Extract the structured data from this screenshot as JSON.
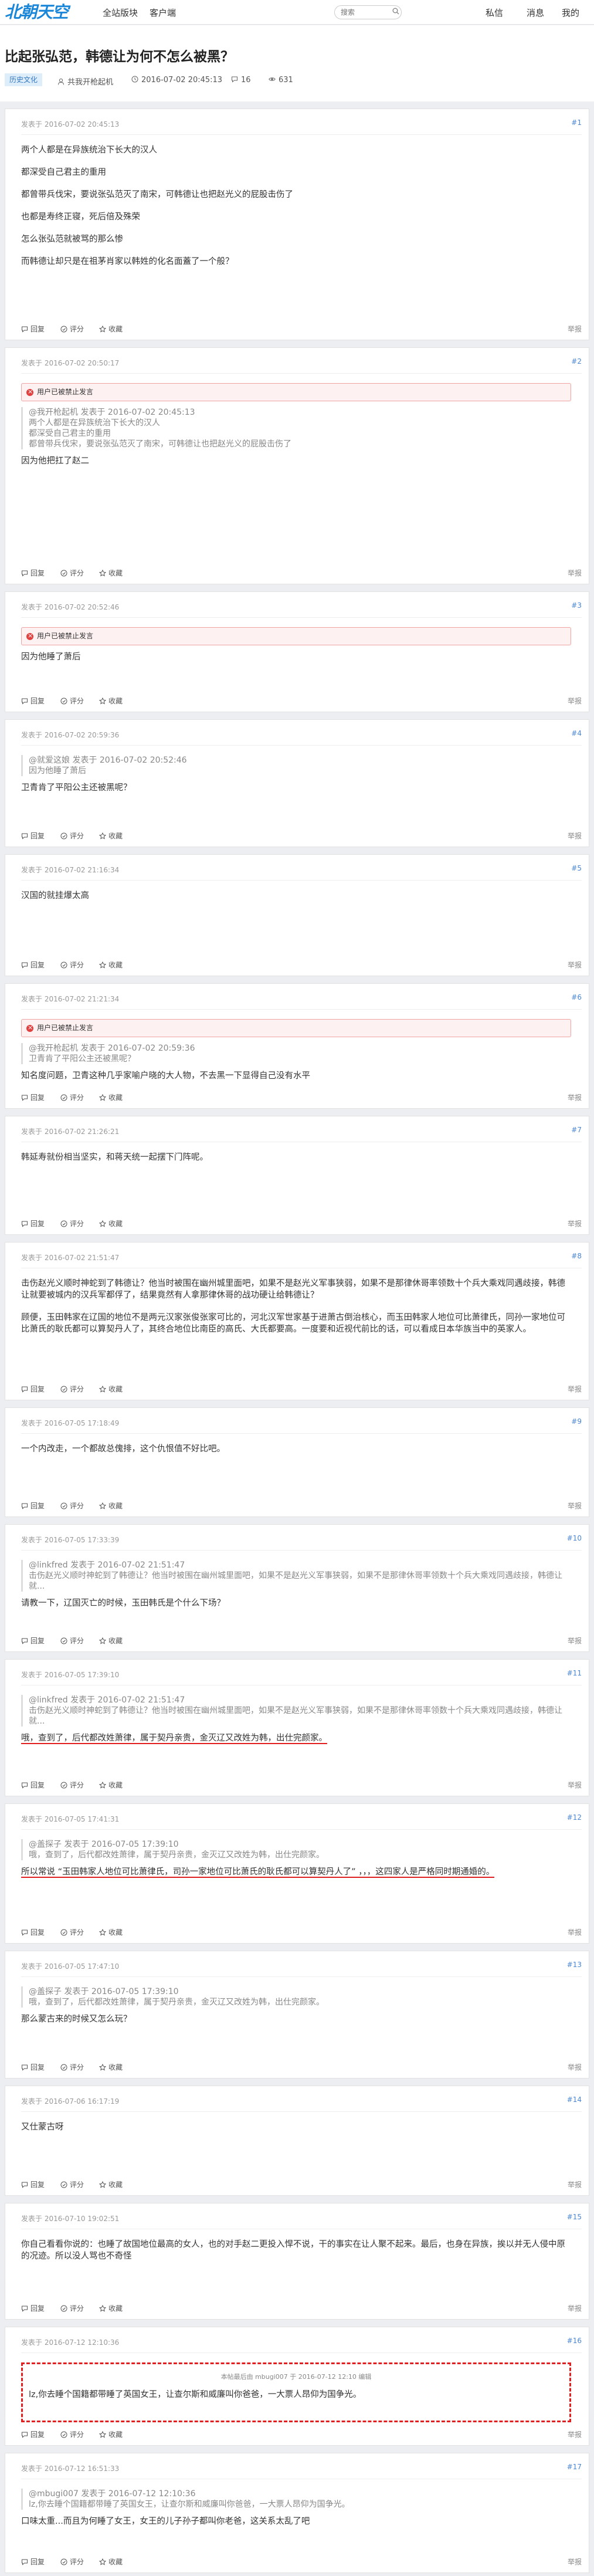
{
  "site": {
    "logo": "北朝天空",
    "nav": [
      "全站版块",
      "客户端"
    ],
    "search_placeholder": "搜索",
    "right_nav": [
      "私信",
      "消息",
      "我的"
    ]
  },
  "thread": {
    "title": "比起张弘范，韩德让为何不怎么被黑？",
    "tag": "历史文化",
    "author": "共我开枪起机",
    "date": "2016-07-02 20:45:13",
    "comments": "16",
    "views": "631"
  },
  "labels": {
    "reply": "回复",
    "rate": "评分",
    "fav": "收藏",
    "report": "举报",
    "deleted": "用户已被禁止发言"
  },
  "posts": [
    {
      "head": "发表于 2016-07-02 20:45:13",
      "floor": "#1",
      "lines": [
        "两个人都是在异族统治下长大的汉人",
        "都深受自己君主的重用",
        "都曾带兵伐宋，要说张弘范灭了南宋，可韩德让也把赵光义的屁股击伤了",
        "也都是寿终正寝，死后倍及殊荣",
        "怎么张弘范就被骂的那么惨",
        "而韩德让却只是在祖茅肖家以韩姓的化名面蓋了一个般？"
      ]
    },
    {
      "head": "发表于 2016-07-02 20:50:17",
      "floor": "#2",
      "quote": [
        "@我开枪起机 发表于 2016-07-02 20:45:13",
        "两个人都是在异族统治下长大的汉人",
        "都深受自己君主的重用",
        "都曾带兵伐宋，要说张弘范灭了南宋，可韩德让也把赵光义的屁股击伤了"
      ],
      "lines": [
        "因为他把扛了赵二"
      ]
    },
    {
      "head": "发表于 2016-07-02 20:52:46",
      "floor": "#3",
      "lines": [
        "因为他睡了萧后"
      ]
    },
    {
      "head": "发表于 2016-07-02 20:59:36",
      "floor": "#4",
      "quote": [
        "@就爱这娘 发表于 2016-07-02 20:52:46",
        "因为他睡了萧后"
      ],
      "lines": [
        "卫青肯了平阳公主还被黑呢？"
      ]
    },
    {
      "head": "发表于 2016-07-02 21:16:34",
      "floor": "#5",
      "lines": [
        "汉国的就挂爆太高"
      ]
    },
    {
      "head": "发表于 2016-07-02 21:21:34",
      "floor": "#6",
      "quote": [
        "@我开枪起机 发表于 2016-07-02 20:59:36",
        "卫青肯了平阳公主还被黑呢？"
      ],
      "lines": [
        "知名度问题，卫青这种几乎家喻户晓的大人物，不去黑一下显得自己没有水平"
      ]
    },
    {
      "head": "发表于 2016-07-02 21:26:21",
      "floor": "#7",
      "lines": [
        "韩延寿就份相当坚实，和蒋天统一起摆下门阵呢。"
      ]
    },
    {
      "head": "发表于 2016-07-02 21:51:47",
      "floor": "#8",
      "lines": [
        "击伤赵光义顺时神蛇到了韩德让？他当时被围在幽州城里面吧，如果不是赵光义军事狭弱，如果不是那律休哥率领数十个兵大乘戏同遇歧接，韩德让就要被城内的汉兵军都俘了，结果竟然有人拿那律休哥的战功硬让给韩德让？",
        "顾便，玉田韩家在辽国的地位不是两元汉家张俊张家可比的，河北汉军世家基于进萧古倒治核心，而玉田韩家人地位可比萧律氏，同孙一家地位可比萧氏的耿氏都可以算契丹人了，其终合地位比南臣的高氏、大氏都要高。一度要和近视代前比的话，可以看成日本华族当中的英家人。"
      ]
    },
    {
      "head": "发表于 2016-07-05 17:18:49",
      "floor": "#9",
      "lines": [
        "一个内改走，一个都故总傀排，这个仇恨值不好比吧。"
      ]
    },
    {
      "head": "发表于 2016-07-05 17:33:39",
      "floor": "#10",
      "quote": [
        "@linkfred 发表于 2016-07-02 21:51:47",
        "击伤赵光义顺时神蛇到了韩德让？他当时被围在幽州城里面吧，如果不是赵光义军事狭弱，如果不是那律休哥率领数十个兵大乘戏同遇歧接，韩德让就..."
      ],
      "lines": [
        "请教一下，辽国灭亡的时候，玉田韩氏是个什么下场？"
      ]
    },
    {
      "head": "发表于 2016-07-05 17:39:10",
      "floor": "#11",
      "quote": [
        "@linkfred 发表于 2016-07-02 21:51:47",
        "击伤赵光义顺时神蛇到了韩德让？他当时被围在幽州城里面吧，如果不是赵光义军事狭弱，如果不是那律休哥率领数十个兵大乘戏同遇歧接，韩德让就..."
      ],
      "lines_u": [
        "哦，查到了，后代都改姓萧律，属于契丹亲贵，金灭辽又改姓为韩，出仕完颜家。"
      ]
    },
    {
      "head": "发表于 2016-07-05 17:41:31",
      "floor": "#12",
      "quote": [
        "@盖探子 发表于 2016-07-05 17:39:10",
        "哦，查到了，后代都改姓萧律，属于契丹亲贵，金灭辽又改姓为韩，出仕完颜家。"
      ],
      "lines_u2": [
        "所以常说 “玉田韩家人地位可比萧律氏，司孙一家地位可比萧氏的耿氏都可以算契丹人了” ，，，这四家人是严格同时期通婚的。"
      ]
    },
    {
      "head": "发表于 2016-07-05 17:47:10",
      "floor": "#13",
      "quote": [
        "@盖探子 发表于 2016-07-05 17:39:10",
        "哦，查到了，后代都改姓萧律，属于契丹亲贵，金灭辽又改姓为韩，出仕完颜家。"
      ],
      "lines": [
        "那么蒙古来的时候又怎么玩？"
      ]
    },
    {
      "head": "发表于 2016-07-06 16:17:19",
      "floor": "#14",
      "lines": [
        "又仕蒙古呀"
      ]
    },
    {
      "head": "发表于 2016-07-10 19:02:51",
      "floor": "#15",
      "lines": [
        "你自己看看你说的：也睡了故国地位最高的女人，也的对手赵二更投入悍不说，干的事实在让人聚不起来。最后，也身在异族，挨以并无人侵中原的况迹。所以没人骂也不奇怪"
      ]
    },
    {
      "head": "发表于 2016-07-12 12:10:36",
      "floor": "#16",
      "edit": "本帖最后由 mbugi007 于 2016-07-12 12:10 编辑",
      "lines": [
        "lz,你去睡个国籍都带睡了英国女王，让查尔斯和威廉叫你爸爸，一大票人昂仰为国争光。"
      ]
    },
    {
      "head": "发表于 2016-07-12 16:51:33",
      "floor": "#17",
      "quote": [
        "@mbugi007 发表于 2016-07-12 12:10:36",
        "lz,你去睡个国籍都带睡了英国女王，让查尔斯和威廉叫你爸爸，一大票人昂仰为国争光。"
      ],
      "lines": [
        "口味太重...而且为何睡了女王，女王的儿子孙子都叫你老爸，这关系太乱了吧"
      ]
    }
  ]
}
